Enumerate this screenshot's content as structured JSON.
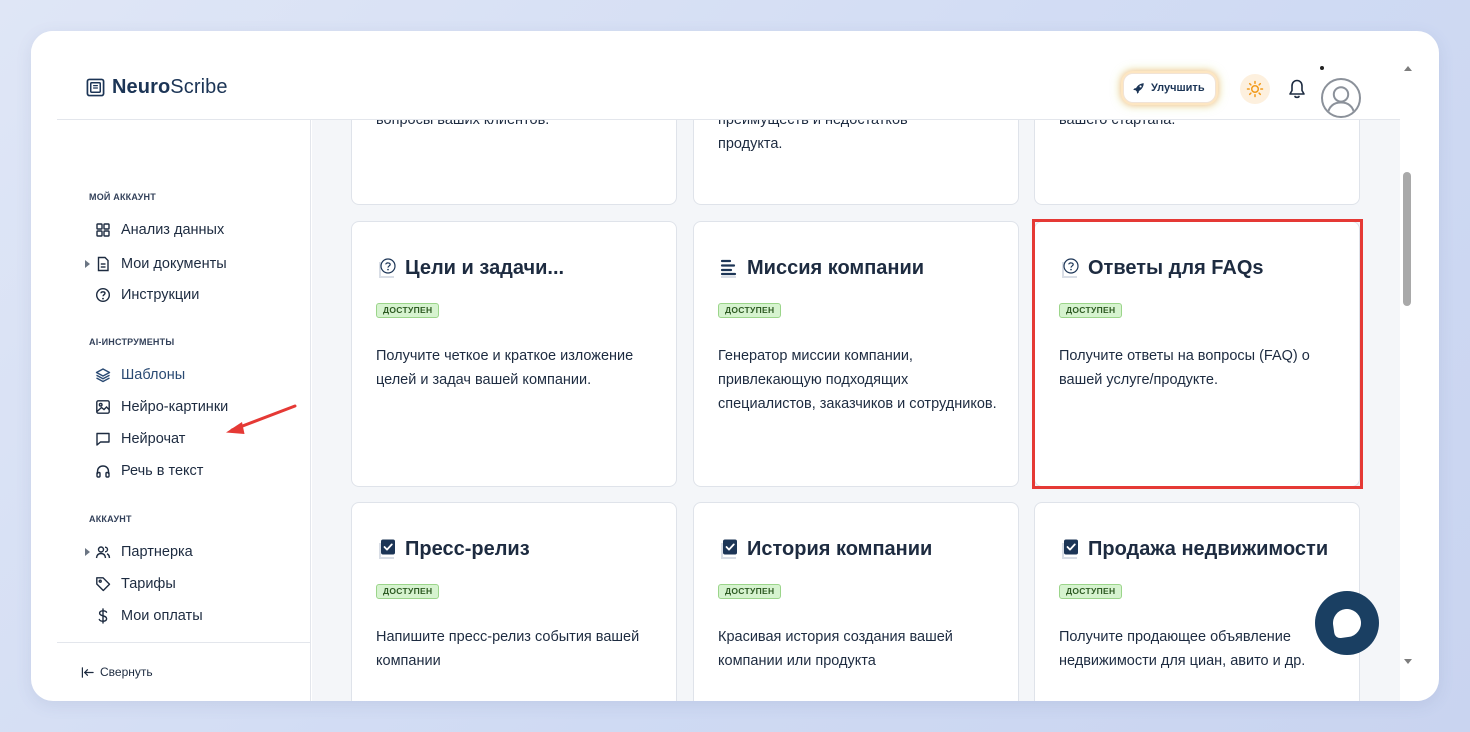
{
  "app": {
    "logo_bold": "Neuro",
    "logo_regular": "Scribe"
  },
  "header": {
    "upgrade_label": "Улучшить",
    "icons": [
      "rocket-icon",
      "sun-icon",
      "bell-icon",
      "avatar"
    ]
  },
  "sidebar": {
    "sections": [
      {
        "label": "МОЙ АККАУНТ",
        "items": [
          {
            "label": "Анализ данных",
            "icon": "grid-icon",
            "expandable": false
          },
          {
            "label": "Мои документы",
            "icon": "document-icon",
            "expandable": true
          },
          {
            "label": "Инструкции",
            "icon": "help-circle-icon",
            "expandable": false
          }
        ]
      },
      {
        "label": "AI-ИНСТРУМЕНТЫ",
        "items": [
          {
            "label": "Шаблоны",
            "icon": "layers-icon",
            "expandable": false,
            "active": true
          },
          {
            "label": "Нейро-картинки",
            "icon": "image-icon",
            "expandable": false
          },
          {
            "label": "Нейрочат",
            "icon": "chat-icon",
            "expandable": false
          },
          {
            "label": "Речь в текст",
            "icon": "headphones-icon",
            "expandable": false
          }
        ]
      },
      {
        "label": "АККАУНТ",
        "items": [
          {
            "label": "Партнерка",
            "icon": "users-icon",
            "expandable": true
          },
          {
            "label": "Тарифы",
            "icon": "tag-icon",
            "expandable": false
          },
          {
            "label": "Мои оплаты",
            "icon": "dollar-icon",
            "expandable": false
          }
        ]
      }
    ],
    "collapse_label": "Свернуть"
  },
  "cards_top_partial": [
    {
      "lines": [
        "вопросы ваших клиентов."
      ]
    },
    {
      "lines": [
        "преимуществ и недостатков",
        "продукта."
      ]
    },
    {
      "lines": [
        "вашего стартапа."
      ]
    }
  ],
  "cards": [
    {
      "title": "Цели и задачи...",
      "icon": "question-doc-icon",
      "badge": "ДОСТУПЕН",
      "description": "Получите четкое и краткое изложение целей и задач вашей компании."
    },
    {
      "title": "Миссия компании",
      "icon": "lines-doc-icon",
      "badge": "ДОСТУПЕН",
      "description": "Генератор миссии компании, привлекающую подходящих специалистов, заказчиков и сотрудников."
    },
    {
      "title": "Ответы для FAQs",
      "icon": "question-doc-icon",
      "badge": "ДОСТУПЕН",
      "description": "Получите ответы на вопросы (FAQ) о вашей услуге/продукте.",
      "highlighted": true
    },
    {
      "title": "Пресс-релиз",
      "icon": "check-doc-icon",
      "badge": "ДОСТУПЕН",
      "description": "Напишите пресс-релиз события вашей компании"
    },
    {
      "title": "История компании",
      "icon": "check-doc-icon",
      "badge": "ДОСТУПЕН",
      "description": "Красивая история создания вашей компании или продукта"
    },
    {
      "title": "Продажа недвижимости",
      "icon": "check-doc-icon",
      "badge": "ДОСТУПЕН",
      "description": "Получите продающее объявление недвижимости для циан, авито и др."
    }
  ],
  "colors": {
    "brand": "#1c3556",
    "badge_bg": "#d6f3cf",
    "highlight": "#e53935",
    "chat_fab": "#1a3f62"
  }
}
